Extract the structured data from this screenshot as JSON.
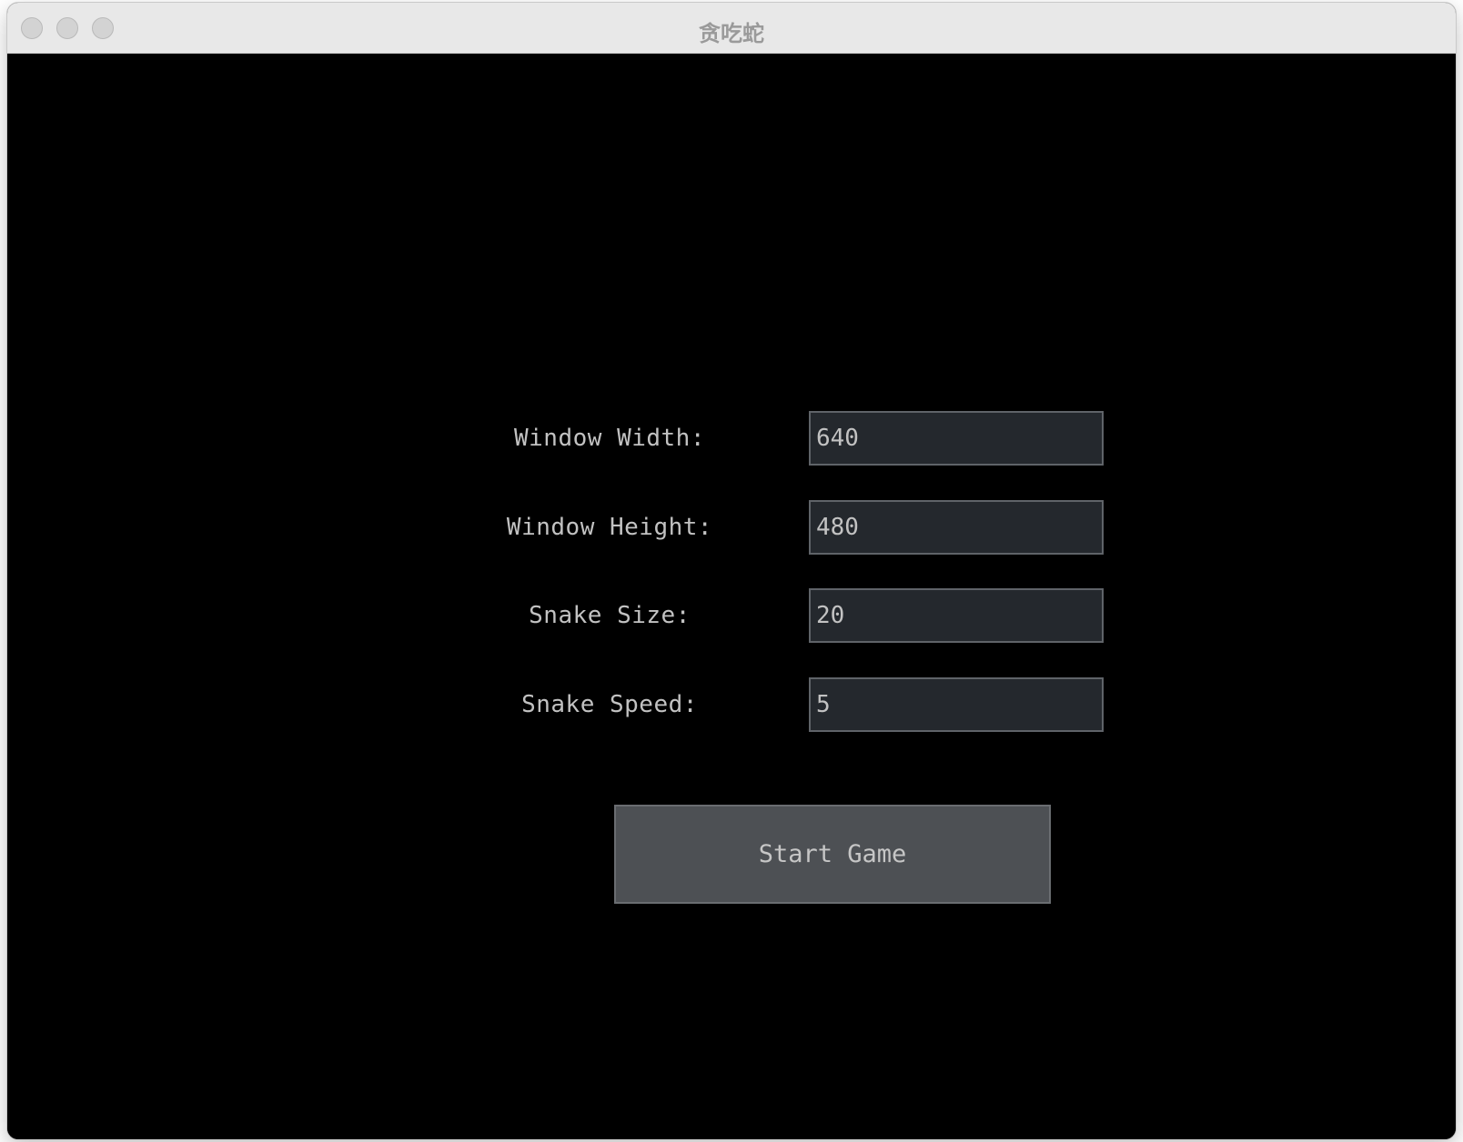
{
  "window": {
    "title": "贪吃蛇"
  },
  "form": {
    "fields": [
      {
        "label": "Window Width:",
        "value": "640"
      },
      {
        "label": "Window Height:",
        "value": "480"
      },
      {
        "label": "Snake Size:",
        "value": "20"
      },
      {
        "label": "Snake Speed:",
        "value": "5"
      }
    ],
    "start_button_label": "Start Game"
  },
  "colors": {
    "background": "#000000",
    "field_background": "#24282d",
    "field_border": "#5f6368",
    "button_background": "#4d5054",
    "text": "#c2c2c2"
  }
}
